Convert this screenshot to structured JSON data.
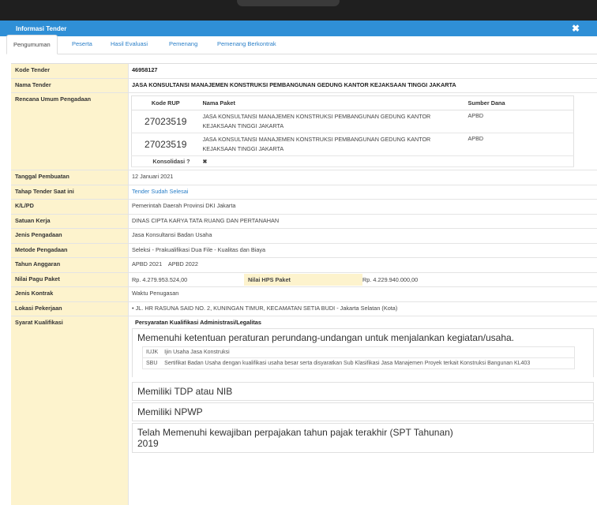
{
  "window": {
    "title": "Informasi Tender",
    "close_glyph": "✖"
  },
  "tabs": [
    "Pengumuman",
    "Peserta",
    "Hasil Evaluasi",
    "Pemenang",
    "Pemenang Berkontrak"
  ],
  "labels": {
    "kode_tender": "Kode Tender",
    "nama_tender": "Nama Tender",
    "rup": "Rencana Umum Pengadaan",
    "tanggal": "Tanggal Pembuatan",
    "tahap": "Tahap Tender Saat ini",
    "klpd": "K/L/PD",
    "satuan": "Satuan Kerja",
    "jenis": "Jenis Pengadaan",
    "metode": "Metode Pengadaan",
    "tahun": "Tahun Anggaran",
    "pagu": "Nilai Pagu Paket",
    "hps": "Nilai HPS Paket",
    "kontrak": "Jenis Kontrak",
    "lokasi": "Lokasi Pekerjaan",
    "syarat": "Syarat Kualifikasi"
  },
  "values": {
    "kode_tender": "46958127",
    "nama_tender": "JASA KONSULTANSI MANAJEMEN KONSTRUKSI PEMBANGUNAN GEDUNG KANTOR KEJAKSAAN TINGGI JAKARTA",
    "tanggal": "12 Januari 2021",
    "tahap": "Tender Sudah Selesai",
    "klpd": "Pemerintah Daerah Provinsi DKI Jakarta",
    "satuan": "DINAS CIPTA KARYA TATA RUANG DAN PERTANAHAN",
    "jenis": "Jasa Konsultansi Badan Usaha",
    "metode": "Seleksi - Prakualifikasi Dua File - Kualitas dan Biaya",
    "tahun": "APBD 2021    APBD 2022",
    "pagu": "Rp. 4.279.953.524,00",
    "hps": "Rp. 4.229.940.000,00",
    "kontrak": "Waktu Penugasan",
    "lokasi": "JL. HR RASUNA SAID NO. 2, KUNINGAN TIMUR, KECAMATAN SETIA BUDI - Jakarta Selatan (Kota)"
  },
  "rup": {
    "headers": [
      "Kode RUP",
      "Nama Paket",
      "Sumber Dana"
    ],
    "rows": [
      {
        "kode": "27023519",
        "nama": "JASA KONSULTANSI MANAJEMEN KONSTRUKSI PEMBANGUNAN GEDUNG KANTOR KEJAKSAAN TINGGI JAKARTA",
        "sumber": "APBD"
      },
      {
        "kode": "27023519",
        "nama": "JASA KONSULTANSI MANAJEMEN KONSTRUKSI PEMBANGUNAN GEDUNG KANTOR KEJAKSAAN TINGGI JAKARTA",
        "sumber": "APBD"
      }
    ],
    "konsolidasi_label": "Konsolidasi ?",
    "konsolidasi_value": "✖"
  },
  "syarat": {
    "title": "Persyaratan Kualifikasi Administrasi/Legalitas",
    "item1": "Memenuhi ketentuan peraturan perundang-undangan untuk menjalankan kegiatan/usaha.",
    "izin": [
      {
        "code": "IUJK",
        "desc": "Ijin Usaha Jasa Konstruksi"
      },
      {
        "code": "SBU",
        "desc": "Sertifikat Badan Usaha dengan kualifikasi usaha besar serta disyaratkan Sub Klasifikasi Jasa Manajemen Proyek terkait Konstruksi Bangunan KL403"
      }
    ],
    "item2": "Memiliki TDP atau NIB",
    "item3": "Memiliki NPWP",
    "item4a": "Telah Memenuhi kewajiban perpajakan tahun pajak terakhir (SPT Tahunan)",
    "item4b": "2019"
  }
}
